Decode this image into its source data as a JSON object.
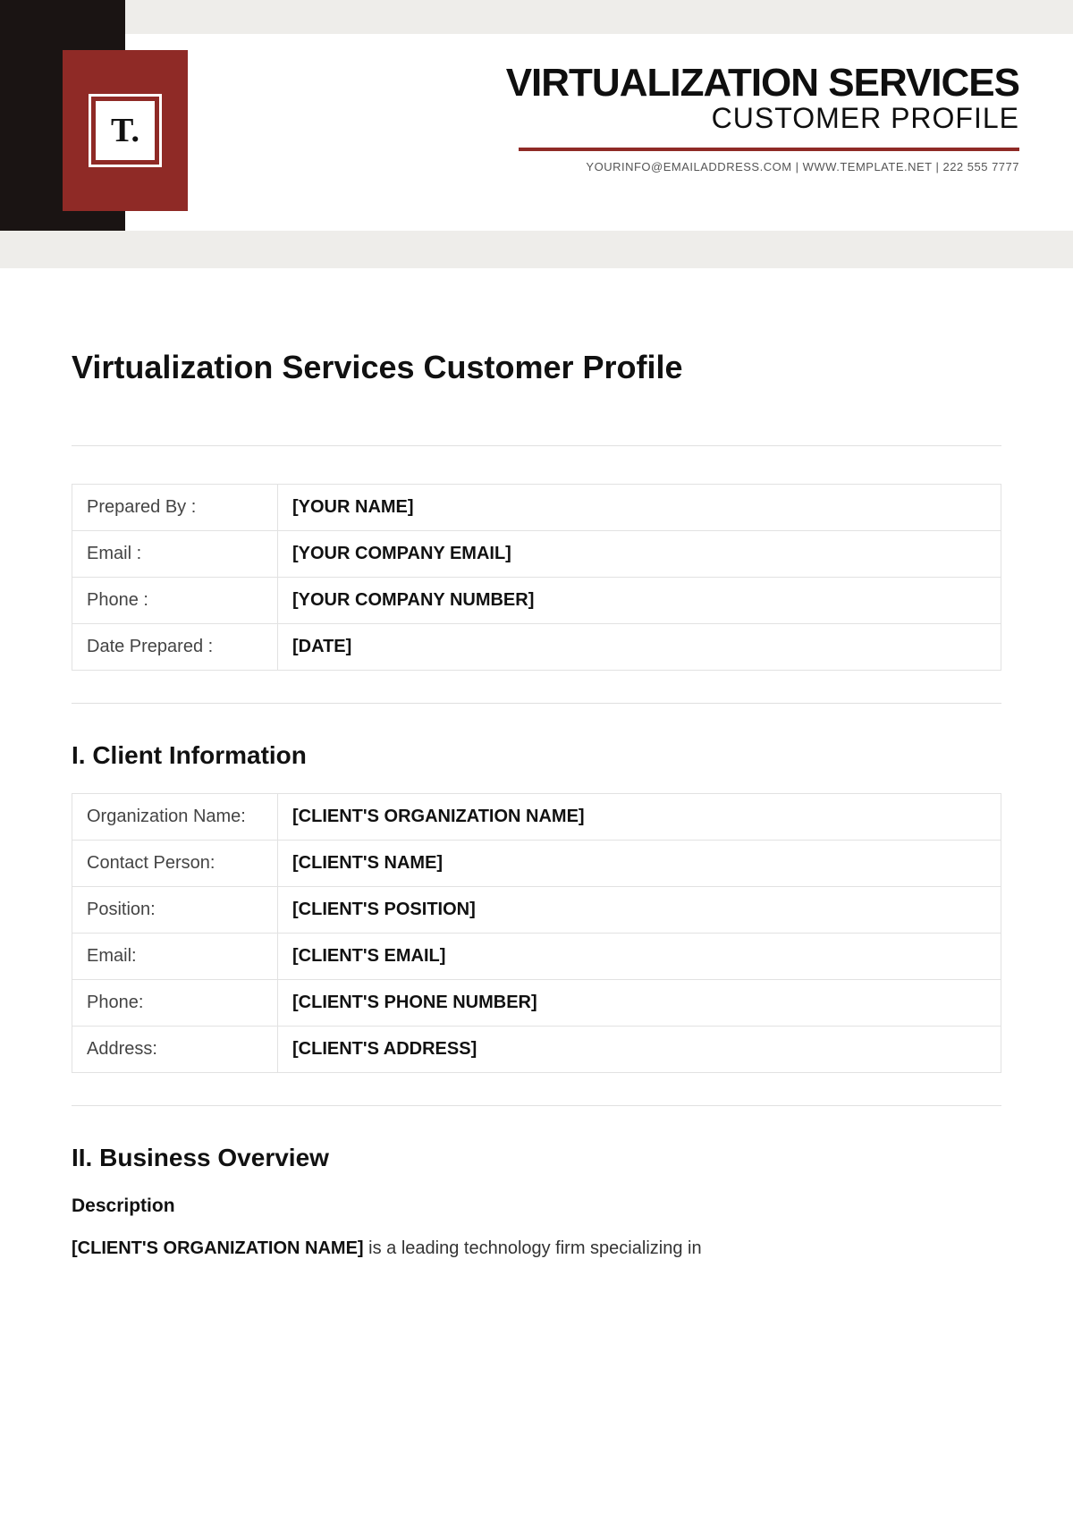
{
  "logo_text": "T.",
  "header": {
    "line1": "VIRTUALIZATION SERVICES",
    "line2": "CUSTOMER PROFILE",
    "contact": "YOURINFO@EMAILADDRESS.COM | WWW.TEMPLATE.NET | 222 555 7777"
  },
  "doc_title": "Virtualization Services Customer Profile",
  "prepared": {
    "rows": [
      {
        "label": "Prepared By :",
        "value": "[YOUR NAME]"
      },
      {
        "label": "Email :",
        "value": "[YOUR COMPANY EMAIL]"
      },
      {
        "label": "Phone :",
        "value": "[YOUR COMPANY NUMBER]"
      },
      {
        "label": "Date Prepared :",
        "value": "[DATE]"
      }
    ]
  },
  "section1": {
    "heading": "I. Client Information",
    "rows": [
      {
        "label": "Organization Name:",
        "value": "[CLIENT'S ORGANIZATION NAME]"
      },
      {
        "label": "Contact Person:",
        "value": "[CLIENT'S NAME]"
      },
      {
        "label": "Position:",
        "value": "[CLIENT'S POSITION]"
      },
      {
        "label": "Email:",
        "value": "[CLIENT'S EMAIL]"
      },
      {
        "label": "Phone:",
        "value": "[CLIENT'S PHONE NUMBER]"
      },
      {
        "label": "Address:",
        "value": "[CLIENT'S ADDRESS]"
      }
    ]
  },
  "section2": {
    "heading": "II. Business Overview",
    "subheading": "Description",
    "para_strong": "[CLIENT'S ORGANIZATION NAME]",
    "para_rest": " is a leading technology firm specializing in"
  }
}
